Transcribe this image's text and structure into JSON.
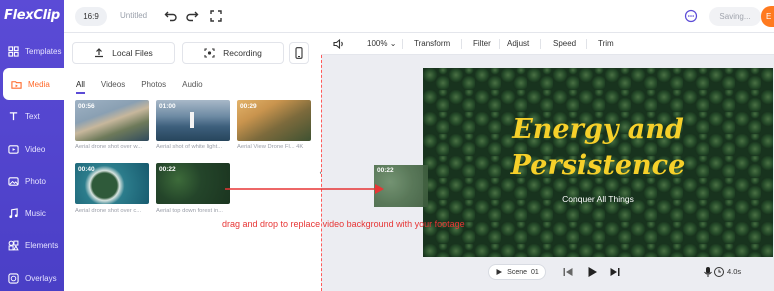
{
  "app": {
    "logo": "FlexClip",
    "project_title": "Untitled",
    "aspect_ratio": "16:9",
    "save_status": "Saving...",
    "export_label": "E"
  },
  "sidebar": {
    "items": [
      {
        "label": "Templates",
        "icon": "templates-icon"
      },
      {
        "label": "Media",
        "icon": "media-icon",
        "active": true
      },
      {
        "label": "Text",
        "icon": "text-icon"
      },
      {
        "label": "Video",
        "icon": "video-icon"
      },
      {
        "label": "Photo",
        "icon": "photo-icon"
      },
      {
        "label": "Music",
        "icon": "music-icon"
      },
      {
        "label": "Elements",
        "icon": "elements-icon"
      },
      {
        "label": "Overlays",
        "icon": "overlays-icon"
      }
    ]
  },
  "media_panel": {
    "local_files_label": "Local Files",
    "recording_label": "Recording",
    "tabs": [
      "All",
      "Videos",
      "Photos",
      "Audio"
    ],
    "active_tab": "All",
    "clips": [
      {
        "duration": "00:56",
        "caption": "Aerial drone shot over w..."
      },
      {
        "duration": "01:00",
        "caption": "Aerial shot of white light..."
      },
      {
        "duration": "00:29",
        "caption": "Aerial View Drone Fl... 4K"
      },
      {
        "duration": "00:40",
        "caption": "Aerial drone shot over c..."
      },
      {
        "duration": "00:22",
        "caption": "Aerial top down forest in..."
      }
    ]
  },
  "editor_toolbar": {
    "zoom": "100%",
    "items": [
      "Transform",
      "Filter",
      "Adjust",
      "Speed",
      "Trim"
    ]
  },
  "canvas": {
    "title_line1": "Energy and",
    "title_line2": "Persistence",
    "subtitle": "Conquer All Things",
    "drag_clip_duration": "00:22",
    "instruction": "drag and drop to replace video background with your footage",
    "colors": {
      "title": "#f6d02a",
      "instruction": "#e73535",
      "accent": "#5b4bd6",
      "brand": "#ff7a1f"
    }
  },
  "playback": {
    "scene_label": "Scene",
    "scene_number": "01",
    "duration": "4.0s"
  }
}
